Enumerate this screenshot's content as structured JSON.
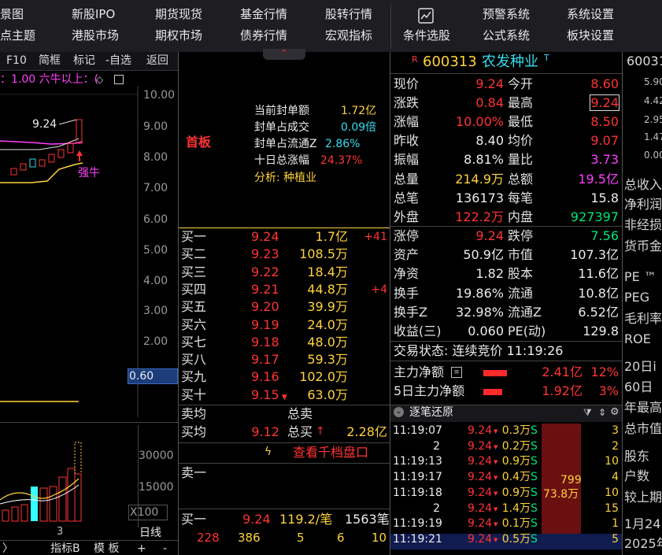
{
  "menu": {
    "row1": [
      "景图",
      "新股IPO",
      "期货现货",
      "基金行情",
      "股转行情",
      "预警系统",
      "系统设置"
    ],
    "row2": [
      "点主题",
      "港股市场",
      "期权市场",
      "债券行情",
      "宏观指标",
      "条件选股",
      "公式系统",
      "板块设置"
    ]
  },
  "toolbar": {
    "buttons": [
      "F10",
      "简框",
      "标记",
      "-自选",
      "返回"
    ]
  },
  "chart": {
    "indicator_text": "：1.00  六牛以上：(",
    "price_axis": [
      "10.00",
      "9.00",
      "8.00",
      "7.00",
      "6.00",
      "5.00",
      "4.00",
      "3.00",
      "2.00"
    ],
    "price_label": "9.24",
    "strong_label": "强牛",
    "price_tag": "0.60",
    "vol_axis": [
      "30000",
      "15000",
      "X100"
    ],
    "period": "日线",
    "day_label": "3",
    "bottom_tabs": [
      "〉",
      "指标B",
      "模 板",
      "+",
      "-"
    ]
  },
  "mid": {
    "limit_up_label": "首板",
    "info": [
      {
        "label": "当前封单额",
        "value": "1.72亿"
      },
      {
        "label": "封单占成交",
        "value": "0.09倍"
      },
      {
        "label": "封单占流通Z",
        "value": "2.86%"
      },
      {
        "label": "十日总涨幅",
        "value": "24.37%"
      }
    ],
    "analysis": "分析: 种植业",
    "bids": [
      {
        "label": "买一",
        "price": "9.24",
        "vol": "1.7亿",
        "chg": "+41"
      },
      {
        "label": "买二",
        "price": "9.23",
        "vol": "108.5万",
        "chg": ""
      },
      {
        "label": "买三",
        "price": "9.22",
        "vol": "18.4万",
        "chg": ""
      },
      {
        "label": "买四",
        "price": "9.21",
        "vol": "44.8万",
        "chg": "+4"
      },
      {
        "label": "买五",
        "price": "9.20",
        "vol": "39.9万",
        "chg": ""
      },
      {
        "label": "买六",
        "price": "9.19",
        "vol": "24.0万",
        "chg": ""
      },
      {
        "label": "买七",
        "price": "9.18",
        "vol": "48.0万",
        "chg": ""
      },
      {
        "label": "买八",
        "price": "9.17",
        "vol": "59.3万",
        "chg": ""
      },
      {
        "label": "买九",
        "price": "9.16",
        "vol": "102.0万",
        "chg": ""
      },
      {
        "label": "买十",
        "price": "9.15",
        "vol": "63.0万",
        "chg": ""
      }
    ],
    "sell_avg_label": "卖均",
    "sell_total_label": "总卖",
    "buy_avg_label": "买均",
    "buy_avg": "9.12",
    "buy_total_label": "总买",
    "buy_total": "2.28亿",
    "view_level10": "查看千档盘口",
    "sell1_label": "卖一",
    "buy1_label": "买一",
    "buy1_price": "9.24",
    "buy1_per": "119.2/笔",
    "buy1_count": "1563笔",
    "queue": [
      "228",
      "386",
      "5",
      "6",
      "10"
    ]
  },
  "quote": {
    "tag": "R",
    "code": "600313",
    "name": "农发种业",
    "suffix": "T",
    "rows": [
      [
        "现价",
        "9.24",
        "red",
        "今开",
        "8.60",
        "red"
      ],
      [
        "涨跌",
        "0.84",
        "red",
        "最高",
        "9.24",
        "red"
      ],
      [
        "涨幅",
        "10.00%",
        "red",
        "最低",
        "8.50",
        "red"
      ],
      [
        "昨收",
        "8.40",
        "wht",
        "均价",
        "9.07",
        "red"
      ],
      [
        "振幅",
        "8.81%",
        "wht",
        "量比",
        "3.73",
        "mag"
      ],
      [
        "总量",
        "214.9万",
        "yel",
        "总额",
        "19.5亿",
        "mag"
      ],
      [
        "总笔",
        "136173",
        "wht",
        "每笔",
        "15.8",
        "wht"
      ],
      [
        "外盘",
        "122.2万",
        "red",
        "内盘",
        "927397",
        "grn"
      ]
    ],
    "rows2": [
      [
        "涨停",
        "9.24",
        "red",
        "跌停",
        "7.56",
        "grn"
      ],
      [
        "资产",
        "50.9亿",
        "wht",
        "市值",
        "107.3亿",
        "wht"
      ],
      [
        "净资",
        "1.82",
        "wht",
        "股本",
        "11.6亿",
        "wht"
      ],
      [
        "换手",
        "19.86%",
        "wht",
        "流通",
        "10.8亿",
        "wht"
      ],
      [
        "换手Z",
        "32.98%",
        "wht",
        "流通Z",
        "6.52亿",
        "wht"
      ],
      [
        "收益(三)",
        "0.060",
        "wht",
        "PE(动)",
        "129.8",
        "wht"
      ]
    ],
    "status": "交易状态: 连续竞价 11:19:26",
    "flow": [
      {
        "label": "主力净额",
        "value": "2.41亿",
        "pct": "12%",
        "fill": 0.7
      },
      {
        "label": "5日主力净额",
        "value": "1.92亿",
        "pct": "3%",
        "fill": 0.55
      }
    ]
  },
  "ticks": {
    "title": "逐笔还原",
    "big_value1": "799",
    "big_value2": "73.8万",
    "rows": [
      [
        "11:19:07",
        "9.24",
        "0.3万",
        "S",
        "3"
      ],
      [
        "2",
        "9.24",
        "0.2万",
        "S",
        "2"
      ],
      [
        "11:19:13",
        "9.24",
        "0.9万",
        "S",
        "10"
      ],
      [
        "11:19:17",
        "9.24",
        "0.4万",
        "S",
        "4"
      ],
      [
        "11:19:18",
        "9.24",
        "0.9万",
        "S",
        "10"
      ],
      [
        "2",
        "9.24",
        "1.4万",
        "S",
        "15"
      ],
      [
        "11:19:19",
        "9.24",
        "0.1万",
        "S",
        "1"
      ],
      [
        "11:19:21",
        "9.24",
        "0.5万",
        "S",
        "5"
      ]
    ]
  },
  "right": {
    "nums": [
      "600313",
      "5.90",
      "4.42",
      "2.95",
      "1.47",
      "0.00"
    ],
    "items": [
      "总收入",
      "净利润",
      "非经损",
      "货币金",
      "PE ™",
      "PEG",
      "毛利率",
      "ROE",
      "20日i",
      "60日",
      "年最高",
      "总市值",
      "股东",
      "户数",
      "较上期",
      "1月24",
      "2025年"
    ]
  },
  "colors": {
    "up": "#ff3333",
    "down": "#00e676",
    "bg": "#000000",
    "ma_yellow": "#ffd23c",
    "ma_magenta": "#ff40ff"
  }
}
